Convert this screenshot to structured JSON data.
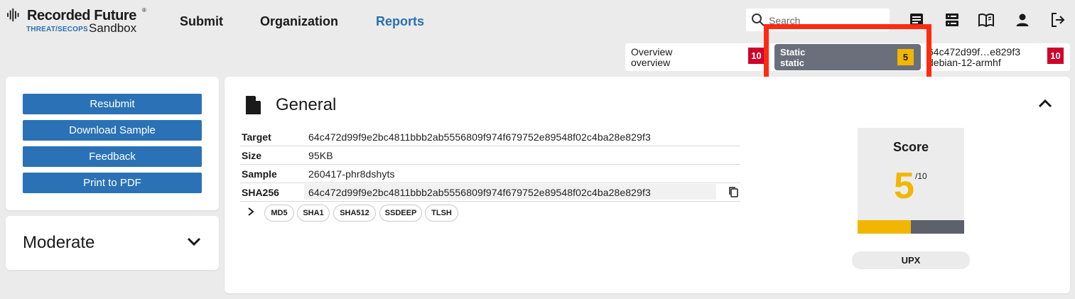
{
  "header": {
    "brand": "Recorded Future",
    "brand_mark": "®",
    "brand_sub": "THREAT/SECOPS",
    "product": "Sandbox",
    "nav": [
      {
        "label": "Submit"
      },
      {
        "label": "Organization"
      },
      {
        "label": "Reports",
        "active": true
      }
    ],
    "search_placeholder": "Search",
    "icons": [
      "reports-icon",
      "servers-icon",
      "docs-book-icon",
      "user-icon",
      "logout-icon"
    ]
  },
  "tabs": [
    {
      "title": "Overview",
      "subtitle": "overview",
      "score": "10"
    },
    {
      "title": "Static",
      "subtitle": "static",
      "score": "5",
      "active": true
    },
    {
      "title": "64c472d99f…e829f3",
      "subtitle": "debian-12-armhf",
      "score": "10"
    }
  ],
  "actions": {
    "buttons": [
      "Resubmit",
      "Download Sample",
      "Feedback",
      "Print to PDF"
    ]
  },
  "verdict": {
    "label": "Moderate"
  },
  "general": {
    "title": "General",
    "rows": [
      {
        "key": "Target",
        "value": "64c472d99f9e2bc4811bbb2ab5556809f974f679752e89548f02c4ba28e829f3"
      },
      {
        "key": "Size",
        "value": "95KB"
      },
      {
        "key": "Sample",
        "value": "260417-phr8dshyts"
      },
      {
        "key": "SHA256",
        "value": "64c472d99f9e2bc4811bbb2ab5556809f974f679752e89548f02c4ba28e829f3"
      }
    ],
    "hash_pills": [
      "MD5",
      "SHA1",
      "SHA512",
      "SSDEEP",
      "TLSH"
    ],
    "score_label": "Score",
    "score_value": "5",
    "score_max": "/10",
    "score_fraction": 0.5,
    "tag": "UPX"
  },
  "colors": {
    "accent_blue": "#2a72b5",
    "score_yellow": "#f2b600",
    "score_red": "#d0002a",
    "highlight": "#ff2a12"
  }
}
